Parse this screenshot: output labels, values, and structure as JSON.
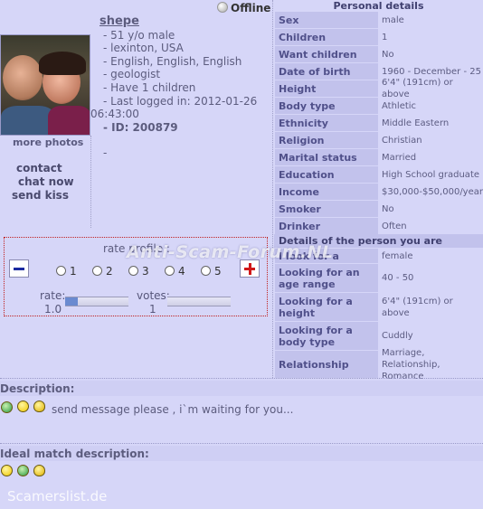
{
  "status": {
    "label": "Offline"
  },
  "profile": {
    "name": "shepe",
    "lines": [
      "- 51 y/o male",
      "- lexinton, USA",
      "- English, English, English",
      "- geologist",
      "- Have 1 children",
      "- Last logged in: 2012-01-26"
    ],
    "login_time": "06:43:00",
    "id_line": "- ID: 200879",
    "dash": "-"
  },
  "left": {
    "more_photos": "more photos",
    "contact": "contact",
    "chat_now": "chat now",
    "send_kiss": "send kiss"
  },
  "rating": {
    "title": "rate profile :",
    "options": [
      "1",
      "2",
      "3",
      "4",
      "5"
    ],
    "rate_label": "rate:",
    "rate_value": "1.0",
    "votes_label": "votes:",
    "votes_value": "1",
    "rate_fill_fraction": 0.2,
    "minus_icon": "minus-icon",
    "plus_icon": "plus-icon"
  },
  "personal_details": {
    "title": "Personal details",
    "rows": [
      {
        "key": "Sex",
        "value": "male"
      },
      {
        "key": "Children",
        "value": "1"
      },
      {
        "key": "Want children",
        "value": "No"
      },
      {
        "key": "Date of birth",
        "value": "1960 - December - 25"
      },
      {
        "key": "Height",
        "value": "6'4\" (191cm) or above"
      },
      {
        "key": "Body type",
        "value": "Athletic"
      },
      {
        "key": "Ethnicity",
        "value": "Middle Eastern"
      },
      {
        "key": "Religion",
        "value": "Christian"
      },
      {
        "key": "Marital status",
        "value": "Married"
      },
      {
        "key": "Education",
        "value": "High School graduate"
      },
      {
        "key": "Income",
        "value": "$30,000-$50,000/year"
      },
      {
        "key": "Smoker",
        "value": "No"
      },
      {
        "key": "Drinker",
        "value": "Often"
      }
    ]
  },
  "looking_for": {
    "title": "Details of the person you are looking for",
    "rows": [
      {
        "key": "I look for a",
        "value": "female"
      },
      {
        "key": "Looking for an age range",
        "value": "40 -  50"
      },
      {
        "key": "Looking for a height",
        "value": "6'4\" (191cm) or above"
      },
      {
        "key": "Looking for a body type",
        "value": "Cuddly"
      },
      {
        "key": "Relationship",
        "value": "Marriage, Relationship, Romance"
      }
    ]
  },
  "description": {
    "title": "Description:",
    "text": "send message please , i`m waiting for you..."
  },
  "ideal_match": {
    "title": "Ideal match description:"
  },
  "watermarks": {
    "top": "Anti-Scam-Forum.NL",
    "bottom": "Scamerslist.de"
  }
}
